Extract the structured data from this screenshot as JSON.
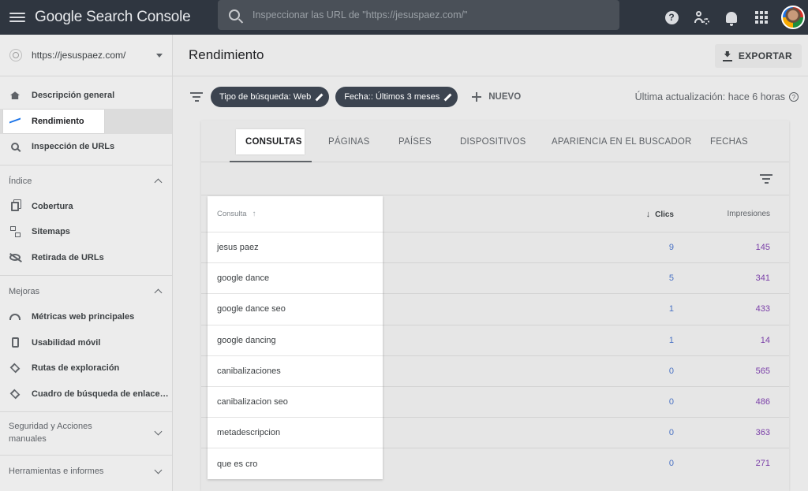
{
  "app": {
    "title": "Google Search Console"
  },
  "search": {
    "placeholder": "Inspeccionar las URL de \"https://jesuspaez.com/\""
  },
  "topbar_icons": [
    "help-icon",
    "user-settings-icon",
    "bell-icon",
    "apps-icon",
    "avatar"
  ],
  "property": {
    "url": "https://jesuspaez.com/"
  },
  "nav": {
    "main": [
      {
        "label": "Descripción general",
        "icon": "home-icon"
      },
      {
        "label": "Rendimiento",
        "icon": "trending-icon",
        "active": true
      },
      {
        "label": "Inspección de URLs",
        "icon": "search-icon"
      }
    ],
    "indice": {
      "title": "Índice",
      "items": [
        {
          "label": "Cobertura",
          "icon": "files-icon"
        },
        {
          "label": "Sitemaps",
          "icon": "sitemap-icon"
        },
        {
          "label": "Retirada de URLs",
          "icon": "eye-off-icon"
        }
      ]
    },
    "mejoras": {
      "title": "Mejoras",
      "items": [
        {
          "label": "Métricas web principales",
          "icon": "gauge-icon"
        },
        {
          "label": "Usabilidad móvil",
          "icon": "phone-icon"
        },
        {
          "label": "Rutas de exploración",
          "icon": "layers-icon"
        },
        {
          "label": "Cuadro de búsqueda de enlace…",
          "icon": "layers-icon"
        }
      ]
    },
    "seguridad": {
      "title": "Seguridad y Acciones",
      "title2": "manuales"
    },
    "herramientas": {
      "title": "Herramientas e informes"
    }
  },
  "header": {
    "title": "Rendimiento",
    "export_label": "EXPORTAR"
  },
  "filters": {
    "chips": [
      "Tipo de búsqueda: Web",
      "Fecha:: Últimos 3 meses"
    ],
    "new_label": "NUEVO",
    "updated": "Última actualización: hace 6 horas",
    "help_glyph": "?"
  },
  "tabs": [
    "CONSULTAS",
    "PÁGINAS",
    "PAÍSES",
    "DISPOSITIVOS",
    "APARIENCIA EN EL BUSCADOR",
    "FECHAS"
  ],
  "table": {
    "col_query": "Consulta",
    "col_clicks": "Clics",
    "col_impressions": "Impresiones",
    "sort_arrow": "↓",
    "query_sort_arrow": "↑",
    "rows": [
      {
        "query": "jesus paez",
        "clicks": "9",
        "impressions": "145"
      },
      {
        "query": "google dance",
        "clicks": "5",
        "impressions": "341"
      },
      {
        "query": "google dance seo",
        "clicks": "1",
        "impressions": "433"
      },
      {
        "query": "google dancing",
        "clicks": "1",
        "impressions": "14"
      },
      {
        "query": "canibalizaciones",
        "clicks": "0",
        "impressions": "565"
      },
      {
        "query": "canibalizacion seo",
        "clicks": "0",
        "impressions": "486"
      },
      {
        "query": "metadescripcion",
        "clicks": "0",
        "impressions": "363"
      },
      {
        "query": "que es cro",
        "clicks": "0",
        "impressions": "271"
      }
    ]
  },
  "colors": {
    "topbar": "#2f3640",
    "chip": "#3c4450",
    "clicks": "#4a72c4",
    "impressions": "#7a3fa8",
    "accent": "#1a73e8"
  }
}
